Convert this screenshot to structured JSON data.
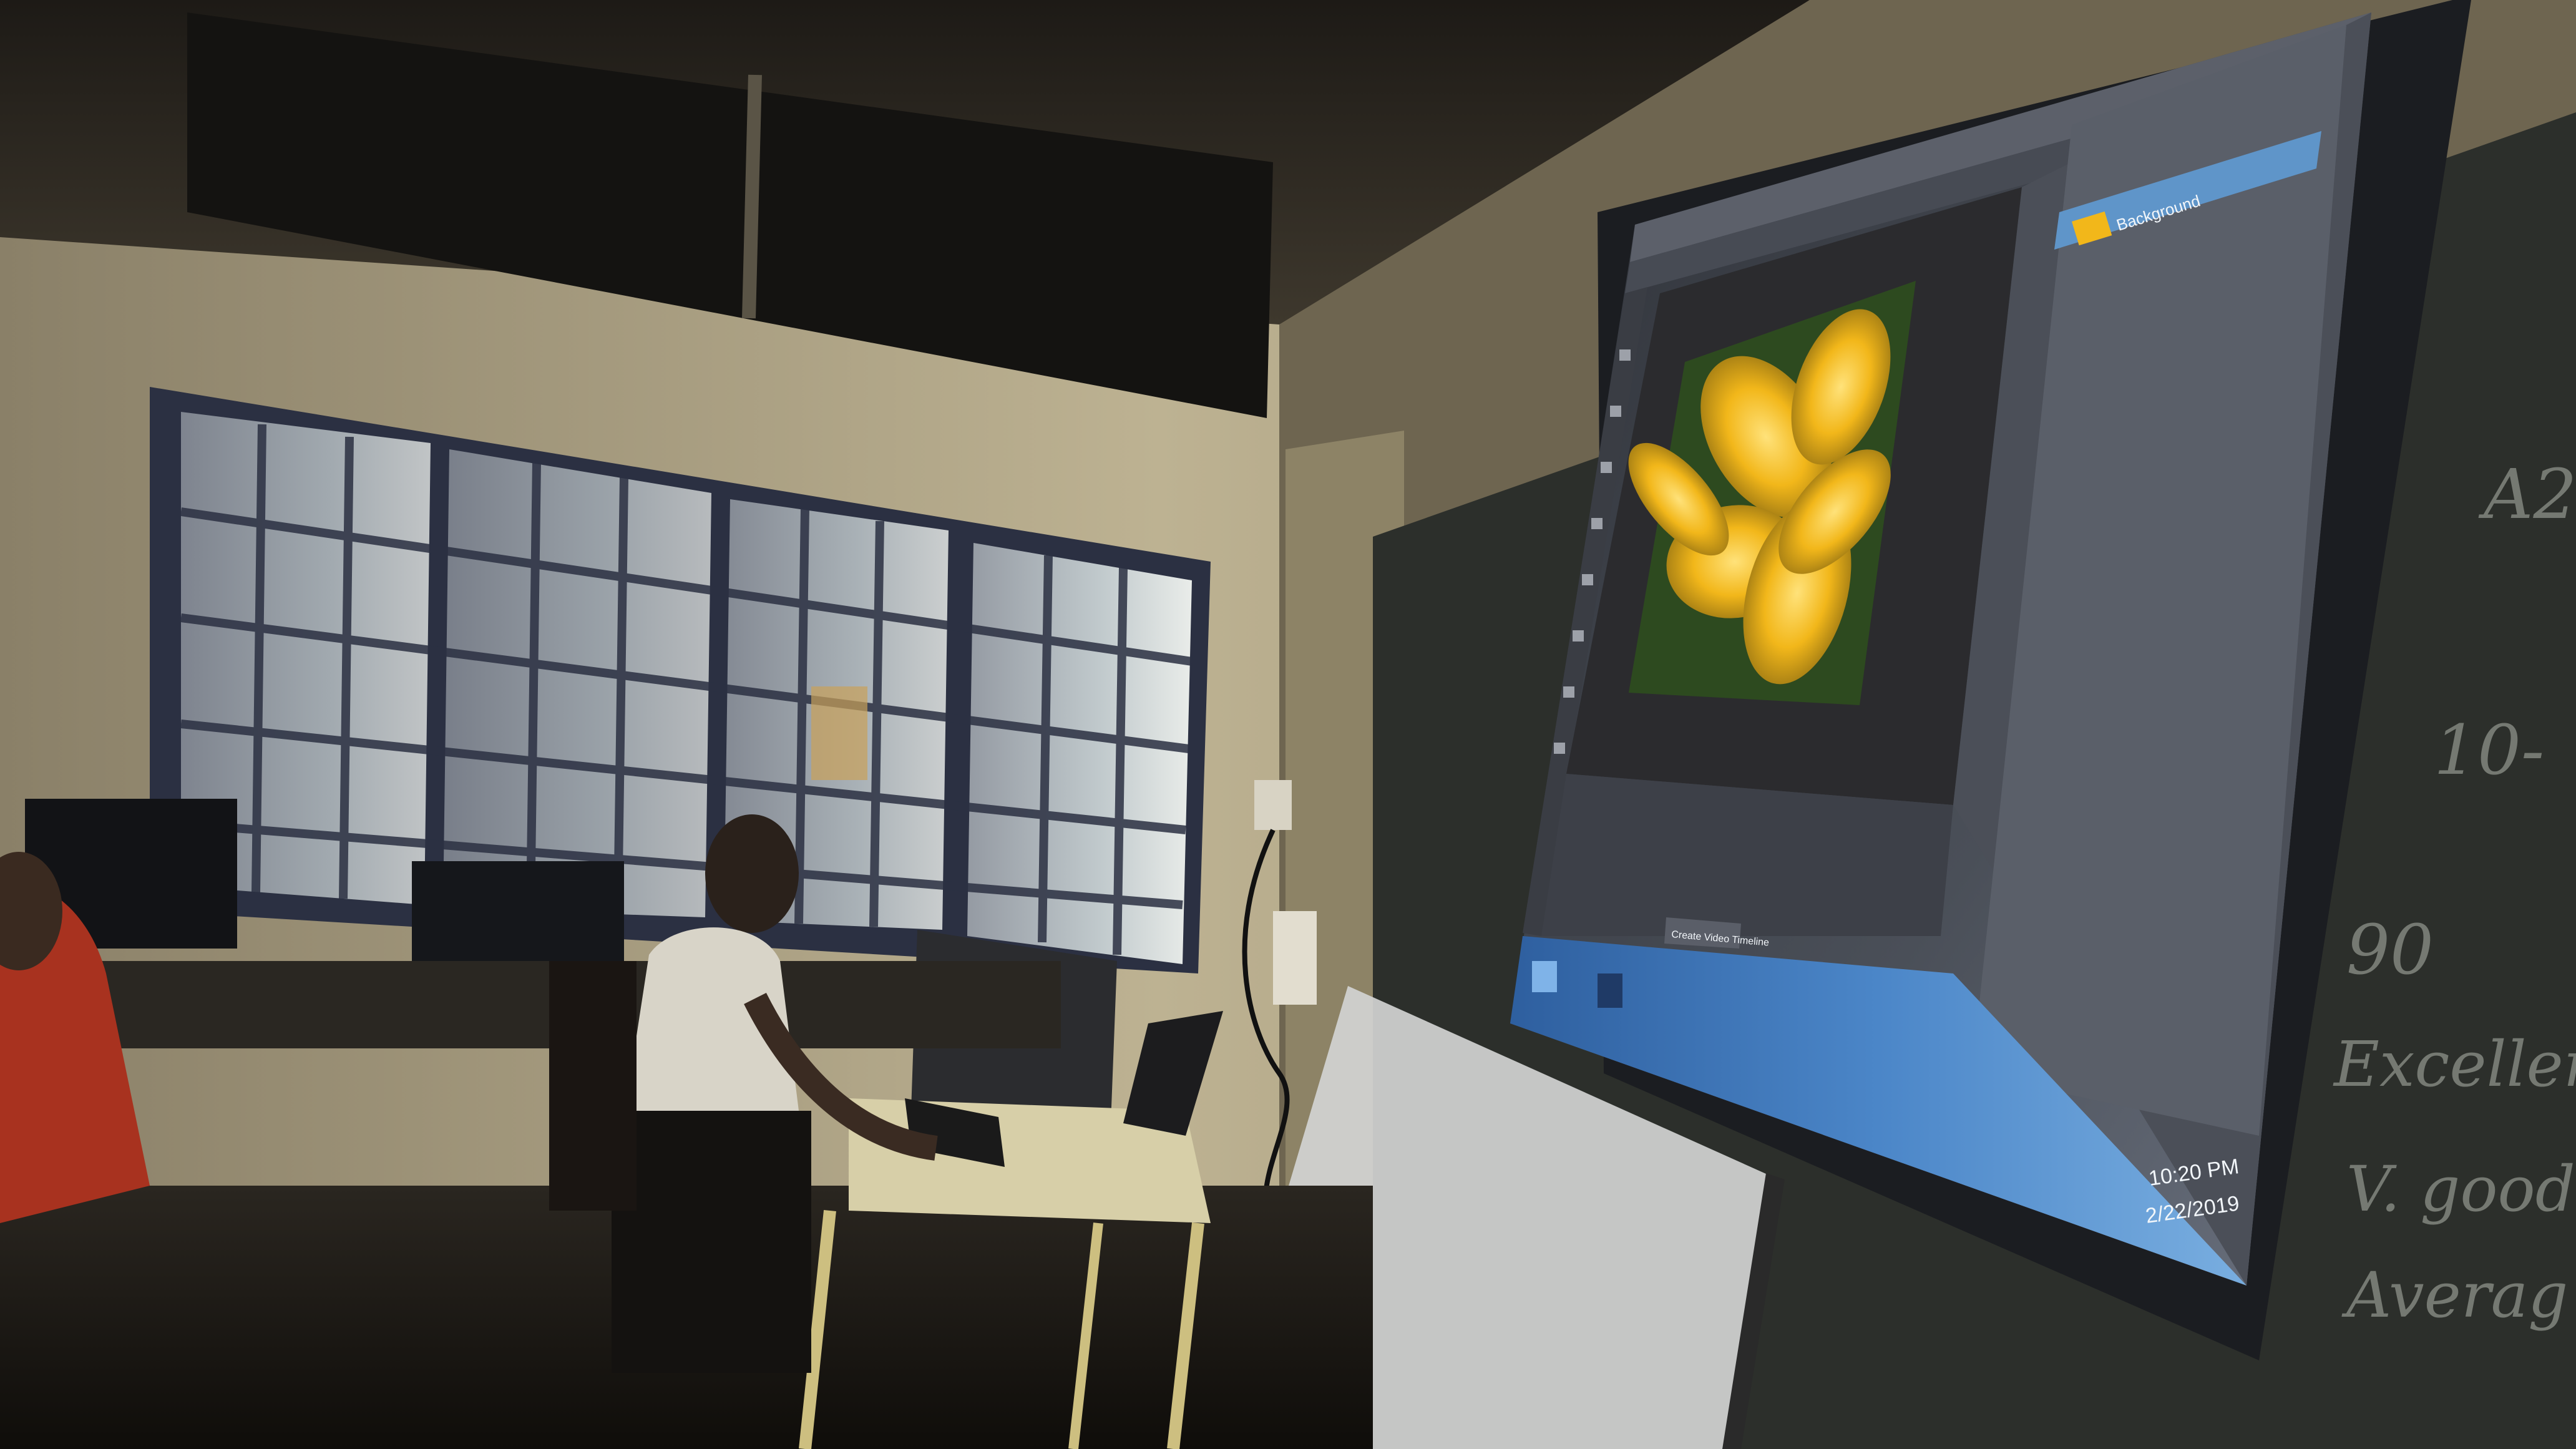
{
  "photo": {
    "subject": "classroom-projector-showing-image-editor",
    "palette": {
      "wall": "#bdb292",
      "wall_shadow": "#6e6550",
      "ceiling": "#2b2720",
      "window_light": "#d9e0dc",
      "window_frame": "#3a3f52",
      "blackboard": "#2c2f2b",
      "projector_screen": "#3b3f47",
      "app_canvas": "#2b2b2e",
      "app_panel": "#4b4f58",
      "taskbar": "#3f6fb0",
      "layer_highlight": "#5f95c9",
      "flower": "#f2b71a",
      "whiteboard": "#d3d4d2"
    }
  },
  "projected_app": {
    "layers_panel": {
      "layer_name": "Background"
    },
    "dialog_button": {
      "label": "Create Video Timeline"
    },
    "taskbar": {
      "clock_time": "10:20 PM",
      "clock_date": "2/22/2019"
    }
  },
  "blackboard_writing": {
    "lines": [
      "A2",
      "10-",
      "90",
      "Excellent",
      "V. good",
      "Averag"
    ]
  }
}
